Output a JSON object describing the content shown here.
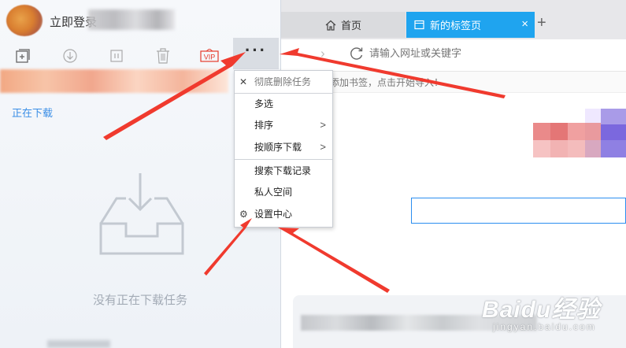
{
  "user": {
    "login_label": "立即登录"
  },
  "toolbar": {
    "buttons": [
      {
        "name": "new-task",
        "icon": "plus-square-icon"
      },
      {
        "name": "start",
        "icon": "download-circle-icon"
      },
      {
        "name": "pause",
        "icon": "pause-icon"
      },
      {
        "name": "delete",
        "icon": "trash-icon"
      },
      {
        "name": "vip",
        "icon": "vip-icon",
        "label": "VIP"
      }
    ],
    "more_label": "···"
  },
  "tabs": {
    "downloading": "正在下载"
  },
  "empty_state": {
    "text": "没有正在下载任务"
  },
  "browser": {
    "tabs": [
      {
        "label": "首页",
        "icon": "home-icon"
      },
      {
        "label": "新的标签页",
        "icon": "page-icon",
        "active": true
      }
    ],
    "new_tab_label": "+",
    "close_label": "×",
    "address_placeholder": "请输入网址或关键字",
    "bookmark_hint": "添加书签，点击开始导入！"
  },
  "menu": {
    "items": [
      {
        "label": "彻底删除任务",
        "icon": "close-icon",
        "disabled": true
      },
      {
        "label": "多选"
      },
      {
        "label": "排序",
        "submenu": true
      },
      {
        "label": "按顺序下载",
        "submenu": true
      },
      {
        "label": "搜索下载记录"
      },
      {
        "label": "私人空间"
      },
      {
        "label": "设置中心",
        "icon": "gear-icon"
      }
    ],
    "submenu_arrow": ">"
  },
  "watermark": {
    "main": "Baidu经验",
    "sub": "jingyan.baidu.com"
  },
  "colors": {
    "accent": "#1fa4ef",
    "link": "#3a8ee6",
    "arrow": "#f03a2e"
  }
}
